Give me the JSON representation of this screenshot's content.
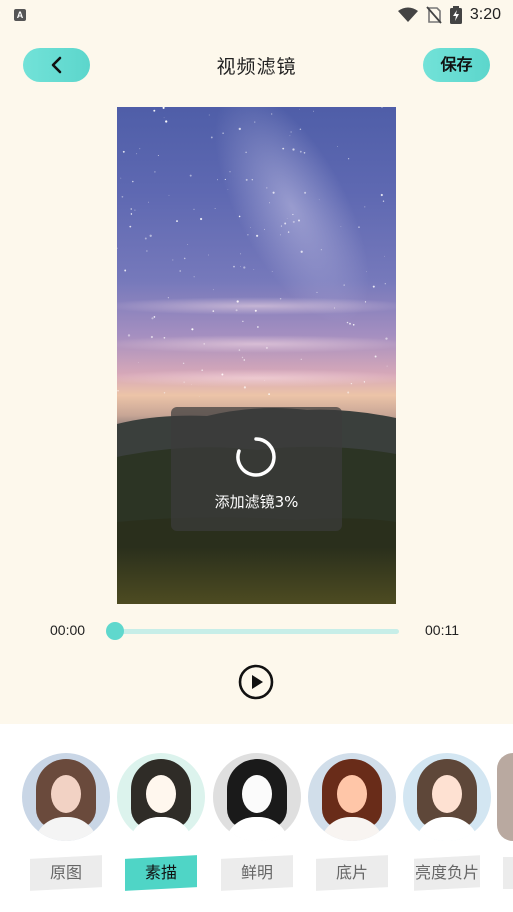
{
  "status_bar": {
    "time": "3:20",
    "left_icon": "a-icon",
    "icons": [
      "wifi-icon",
      "no-sim-icon",
      "battery-charging-icon"
    ]
  },
  "header": {
    "back_icon": "chevron-left-icon",
    "title": "视频滤镜",
    "save_label": "保存"
  },
  "video": {
    "loading_text": "添加滤镜3%",
    "loading_percent": 3
  },
  "playback": {
    "current_time": "00:00",
    "total_time": "00:11",
    "progress": 0,
    "play_icon": "play-icon"
  },
  "filters": [
    {
      "label": "原图",
      "selected": false
    },
    {
      "label": "素描",
      "selected": true
    },
    {
      "label": "鲜明",
      "selected": false
    },
    {
      "label": "底片",
      "selected": false
    },
    {
      "label": "亮度负片",
      "selected": false
    }
  ],
  "colors": {
    "accent": "#5cd6cc",
    "background": "#fdf8ec"
  }
}
